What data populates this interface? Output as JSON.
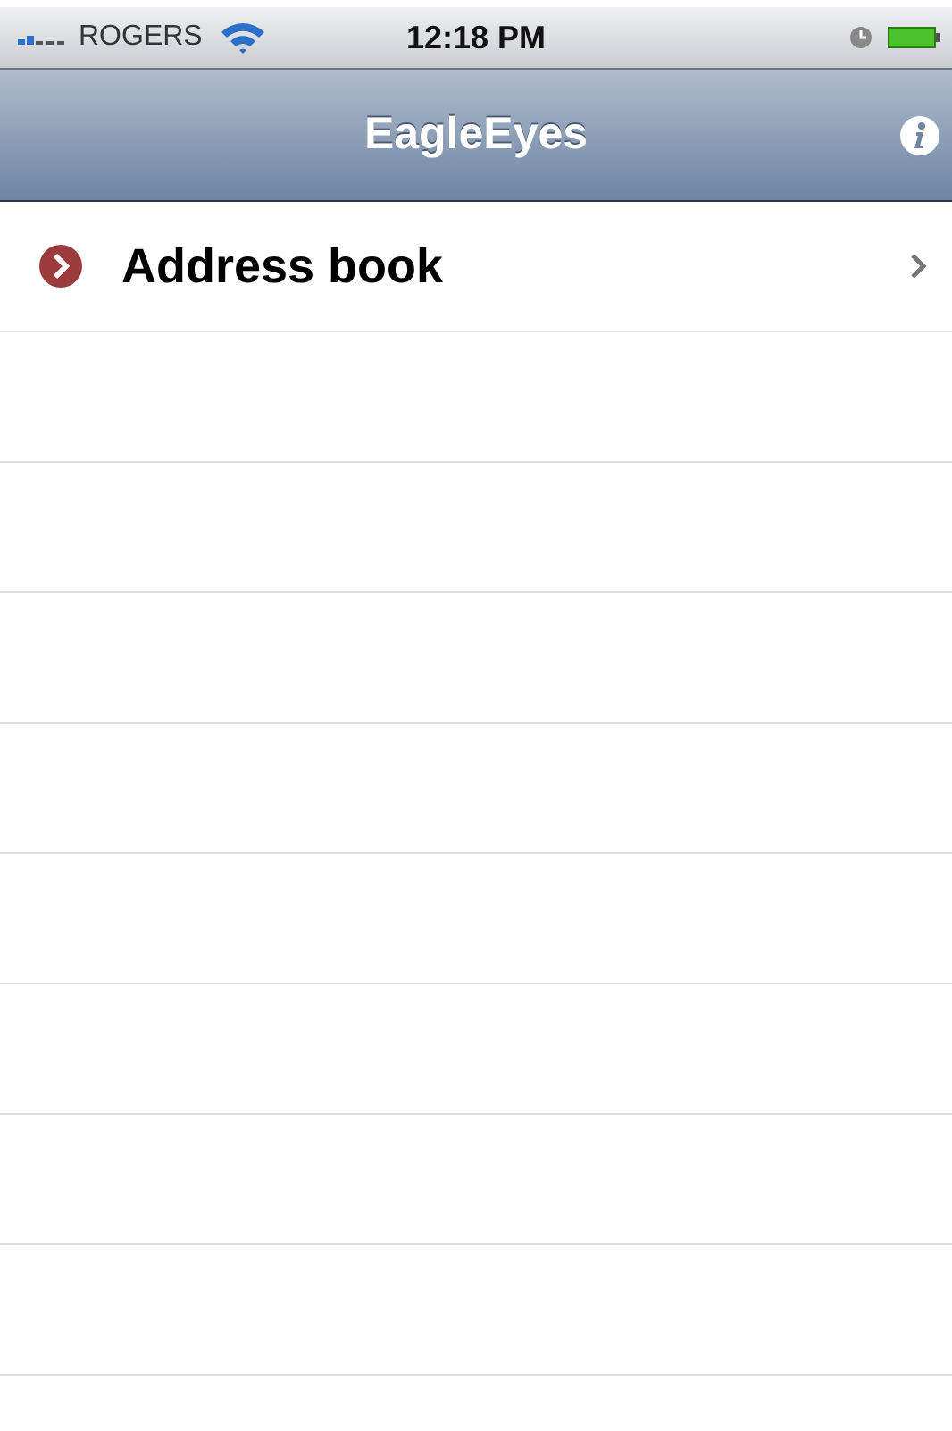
{
  "status_bar": {
    "carrier": "ROGERS",
    "time": "12:18 PM"
  },
  "nav_bar": {
    "title": "EagleEyes"
  },
  "list": {
    "items": [
      {
        "label": "Address book"
      }
    ]
  }
}
